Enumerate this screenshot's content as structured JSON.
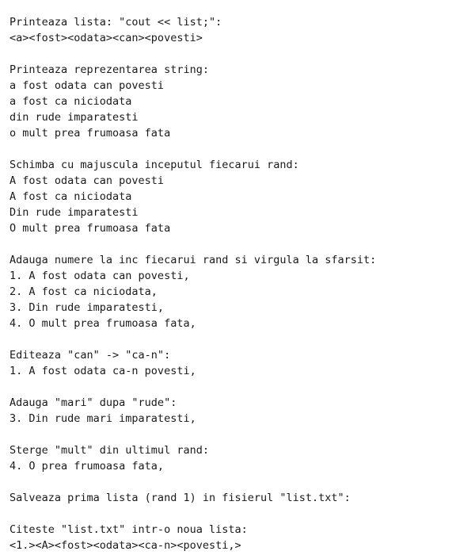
{
  "console": {
    "lines": [
      "Printeaza lista: \"cout << list;\":",
      "<a><fost><odata><can><povesti>",
      "",
      "Printeaza reprezentarea string:",
      "a fost odata can povesti",
      "a fost ca niciodata",
      "din rude imparatesti",
      "o mult prea frumoasa fata",
      "",
      "Schimba cu majuscula inceputul fiecarui rand:",
      "A fost odata can povesti",
      "A fost ca niciodata",
      "Din rude imparatesti",
      "O mult prea frumoasa fata",
      "",
      "Adauga numere la inc fiecarui rand si virgula la sfarsit:",
      "1. A fost odata can povesti,",
      "2. A fost ca niciodata,",
      "3. Din rude imparatesti,",
      "4. O mult prea frumoasa fata,",
      "",
      "Editeaza \"can\" -> \"ca-n\":",
      "1. A fost odata ca-n povesti,",
      "",
      "Adauga \"mari\" dupa \"rude\":",
      "3. Din rude mari imparatesti,",
      "",
      "Sterge \"mult\" din ultimul rand:",
      "4. O prea frumoasa fata,",
      "",
      "Salveaza prima lista (rand 1) in fisierul \"list.txt\":",
      "",
      "Citeste \"list.txt\" intr-o noua lista:",
      "<1.><A><fost><odata><ca-n><povesti,>"
    ]
  }
}
